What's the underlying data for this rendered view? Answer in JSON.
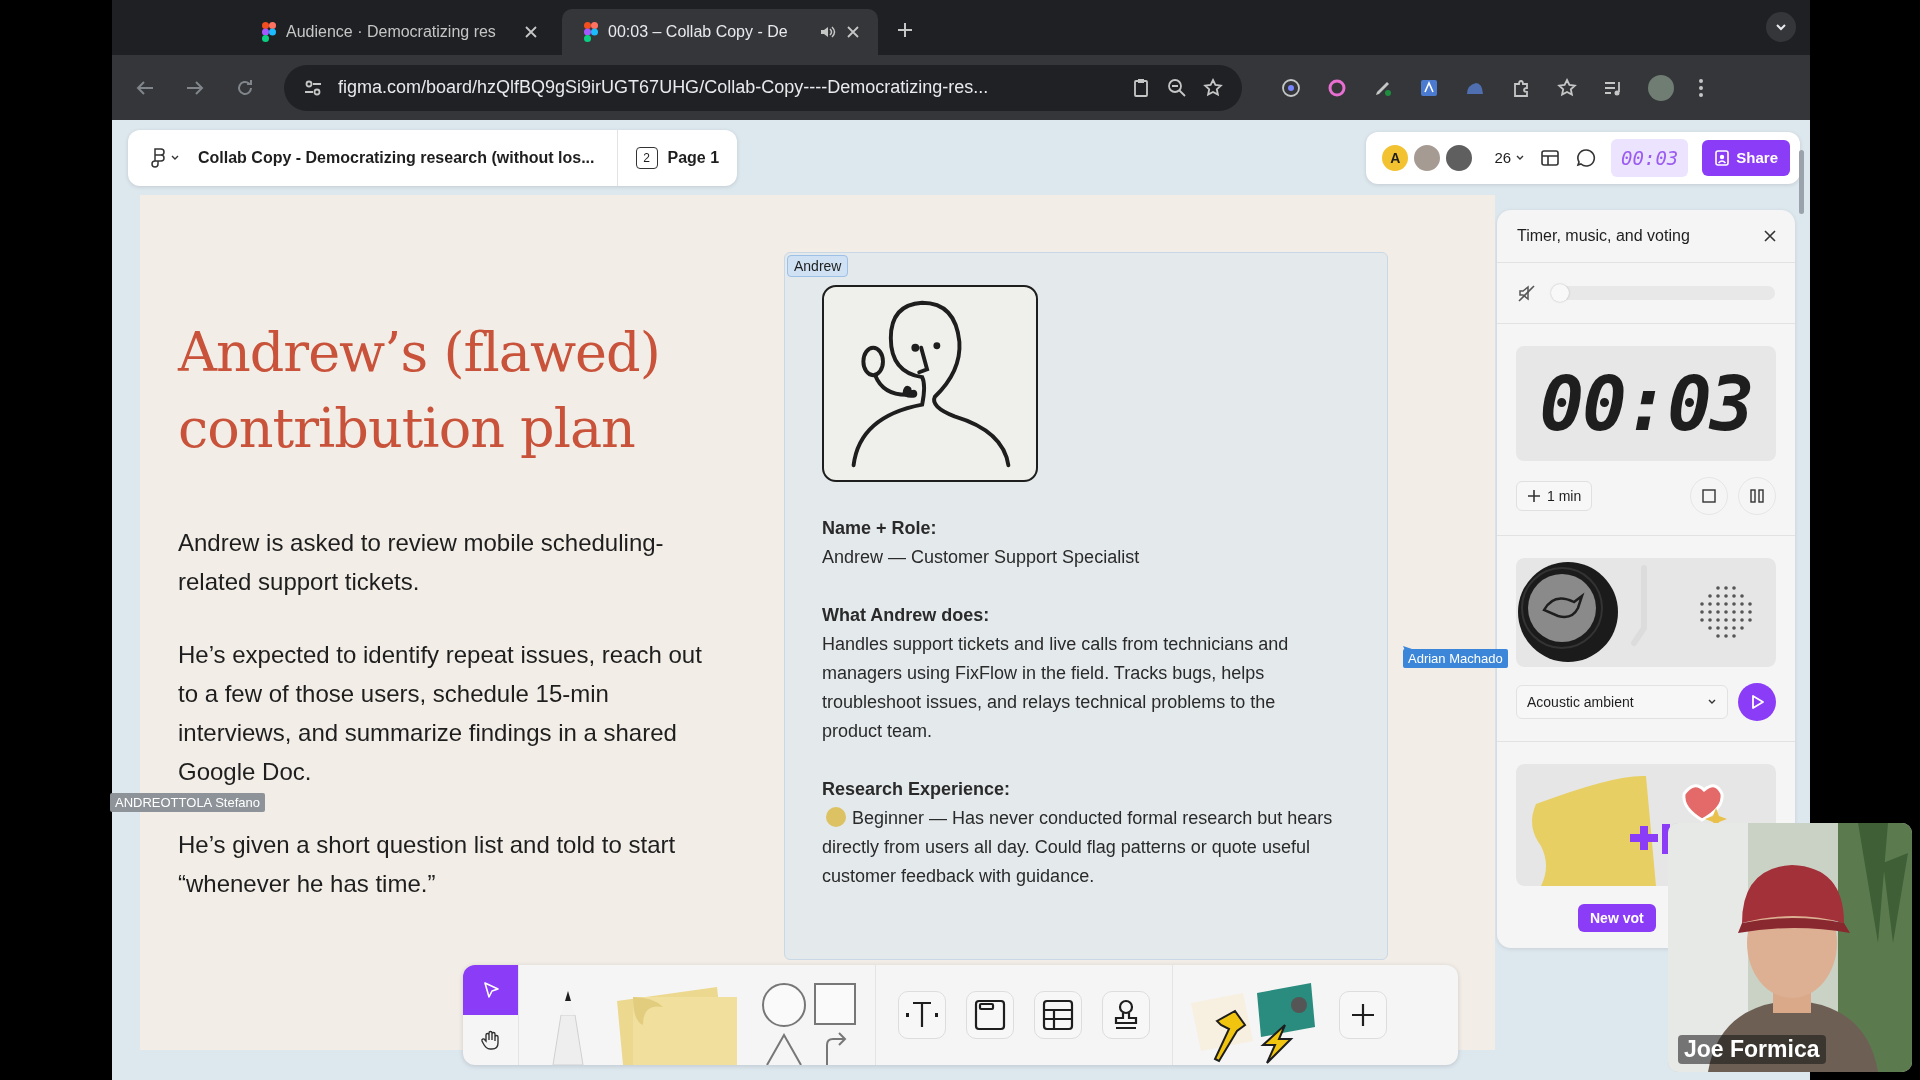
{
  "browser": {
    "tabs": [
      {
        "title": "Audience · Democratizing res",
        "selected": false,
        "audio": false
      },
      {
        "title": "00:03 – Collab Copy - De",
        "selected": true,
        "audio": true
      }
    ],
    "url": "figma.com/board/hzQlfBQ9gSi9irUGT67UHG/Collab-Copy----Democratizing-res..."
  },
  "file_bar": {
    "file_name": "Collab Copy - Democratizing research (without los...",
    "page_count": "2",
    "page": "Page 1"
  },
  "collab_bar": {
    "avatar_initial": "A",
    "viewer_count": "26",
    "timer": "00:03",
    "share": "Share"
  },
  "slide": {
    "title": "Andrew’s (flawed) contribution plan",
    "paragraphs": [
      "Andrew is asked to review mobile scheduling-related support tickets.",
      "He’s expected to identify repeat issues, reach out to a few of those users, schedule 15-min interviews, and summarize findings in a shared Google Doc.",
      "He’s given a short question list and told to start “whenever he has time.”"
    ]
  },
  "card": {
    "tag": "Andrew",
    "sections": [
      {
        "heading": "Name + Role:",
        "body": "Andrew — Customer Support Specialist",
        "marker": false
      },
      {
        "heading": "What Andrew does:",
        "body": "Handles support tickets and live calls from technicians and managers using FixFlow in the field. Tracks bugs, helps troubleshoot issues, and relays technical problems to the product team.",
        "marker": false
      },
      {
        "heading": "Research Experience:",
        "body": "Beginner — Has never conducted formal research but hears directly from users all day. Could flag patterns or quote useful customer feedback with guidance.",
        "marker": true
      }
    ]
  },
  "cursors": [
    {
      "name": "Adrian Machado",
      "color": "#3b86d8"
    },
    {
      "name": "ANDREOTTOLA Stefano",
      "color": "#8e9399"
    }
  ],
  "panel": {
    "title": "Timer, music, and voting",
    "volume": {
      "muted": true,
      "level": 0
    },
    "timer": "00:03",
    "add_time": "1 min",
    "track": "Acoustic ambient",
    "vote_button": "New vot"
  },
  "toolbar": {
    "tools": [
      {
        "kind": "select",
        "selected": true
      },
      {
        "kind": "hand",
        "selected": false
      },
      {
        "kind": "pen",
        "selected": false
      },
      {
        "kind": "sticky",
        "selected": false
      },
      {
        "kind": "shapes",
        "selected": false
      },
      {
        "kind": "text",
        "selected": false
      },
      {
        "kind": "section",
        "selected": false
      },
      {
        "kind": "table",
        "selected": false
      },
      {
        "kind": "stamp",
        "selected": false
      },
      {
        "kind": "stickers",
        "selected": false
      },
      {
        "kind": "more",
        "selected": false
      }
    ]
  },
  "webcam": {
    "kind": "picture",
    "name": "Joe Formica"
  }
}
